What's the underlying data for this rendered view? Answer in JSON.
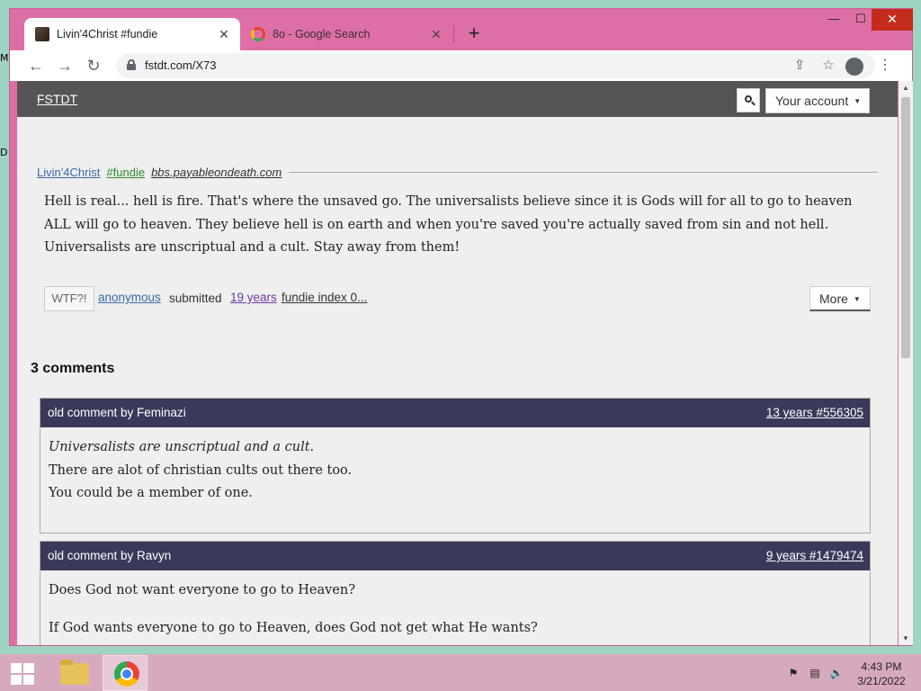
{
  "desktop": {
    "edge_text_1": "M",
    "edge_text_2": "D"
  },
  "browser": {
    "tabs": [
      {
        "title": "Livin'4Christ #fundie",
        "active": true,
        "close": "✕"
      },
      {
        "title": "8o - Google Search",
        "active": false,
        "close": "✕"
      }
    ],
    "new_tab": "+",
    "window_controls": {
      "minimize": "—",
      "maximize": "☐",
      "close": "✕"
    },
    "nav": {
      "back": "←",
      "forward": "→",
      "reload": "↻"
    },
    "url": "fstdt.com/X73",
    "icons": [
      "lock-icon",
      "share-icon",
      "star-icon",
      "profile-icon",
      "kebab-menu-icon"
    ],
    "share_glyph": "⇪",
    "star_glyph": "☆",
    "kebab_glyph": "⋮"
  },
  "site": {
    "brand": "FSTDT",
    "account_label": "Your account",
    "caret": "▼"
  },
  "post": {
    "author": "Livin'4Christ",
    "tag": "#fundie",
    "source": "bbs.payableondeath.com",
    "quote": "Hell is real... hell is fire. That's where the unsaved go. The universalists believe since it is Gods will for all to go to heaven ALL will go to heaven. They believe hell is on earth and when you're saved you're actually saved from sin and not hell. Universalists are unscriptual and a cult. Stay away from them!",
    "wtf_label": "WTF?!",
    "submitter": "anonymous",
    "submitted_text": "submitted",
    "age": "19 years",
    "index_text": "fundie index 0...",
    "more_label": "More"
  },
  "comments": {
    "heading": "3 comments",
    "items": [
      {
        "by": "old comment by Feminazi",
        "link": "13 years #556305",
        "lines": [
          "Universalists are unscriptual and a cult.",
          "There are alot of christian cults out there too.",
          "You could be a member of one."
        ]
      },
      {
        "by": "old comment by Ravyn",
        "link": "9 years #1479474",
        "lines": [
          "Does God not want everyone to go to Heaven?",
          "If God wants everyone to go to Heaven, does God not get what He wants?"
        ]
      }
    ]
  },
  "taskbar": {
    "time": "4:43 PM",
    "date": "3/21/2022",
    "tray": {
      "flag": "⚑",
      "network": "▤",
      "volume": "🔈"
    }
  },
  "scrollbar": {
    "up": "▲",
    "down": "▼"
  }
}
